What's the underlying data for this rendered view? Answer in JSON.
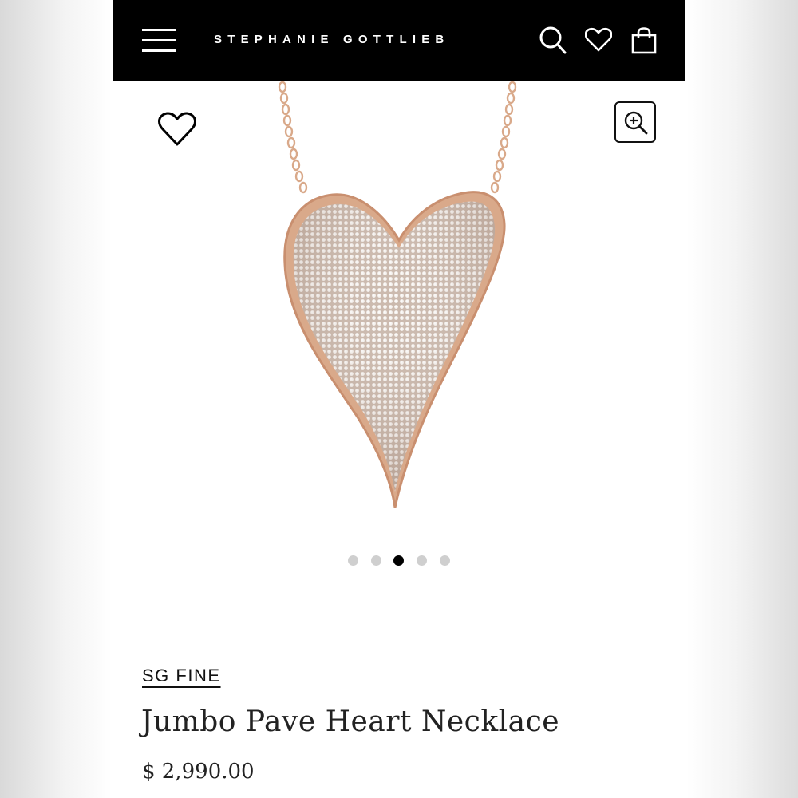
{
  "header": {
    "brand": "STEPHANIE GOTTLIEB",
    "icons": [
      "menu-icon",
      "search-icon",
      "heart-icon",
      "shopping-bag-icon"
    ],
    "background_color": "#000000"
  },
  "gallery": {
    "wishlist_icon": "heart-outline-icon",
    "zoom_icon": "zoom-in-icon",
    "image_subject": "rose gold pave diamond heart pendant necklace",
    "dots_count": 5,
    "active_dot_index": 2
  },
  "product": {
    "brand_line": "SG FINE",
    "title": "Jumbo Pave Heart Necklace",
    "price": "$ 2,990.00"
  },
  "colors": {
    "accent_gold": "#d9a98a",
    "text": "#222222"
  }
}
